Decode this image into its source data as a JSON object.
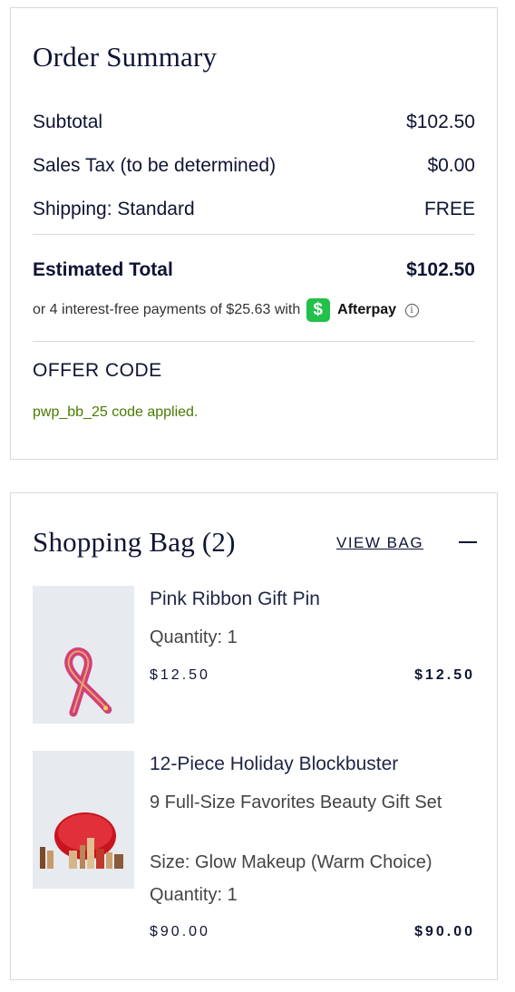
{
  "order_summary": {
    "title": "Order Summary",
    "subtotal_label": "Subtotal",
    "subtotal_value": "$102.50",
    "tax_label": "Sales Tax (to be determined)",
    "tax_value": "$0.00",
    "shipping_label": "Shipping: Standard",
    "shipping_value": "FREE",
    "total_label": "Estimated Total",
    "total_value": "$102.50",
    "afterpay_text": "or 4 interest-free payments of $25.63 with",
    "afterpay_badge": "$",
    "afterpay_name": "Afterpay",
    "afterpay_info": "i",
    "offer_title": "OFFER CODE",
    "offer_applied": "pwp_bb_25 code applied."
  },
  "shopping_bag": {
    "title": "Shopping Bag (2)",
    "view_bag_label": "VIEW BAG",
    "items": [
      {
        "name": "Pink Ribbon Gift Pin",
        "quantity": "Quantity: 1",
        "unit_price": "$12.50",
        "total_price": "$12.50"
      },
      {
        "name": "12-Piece Holiday Blockbuster",
        "subtitle": "9 Full-Size Favorites Beauty Gift Set",
        "size": "Size: Glow Makeup (Warm Choice)",
        "quantity": "Quantity: 1",
        "unit_price": "$90.00",
        "total_price": "$90.00"
      }
    ]
  },
  "colors": {
    "navy_text": "#0f1433",
    "afterpay_green": "#21c14a",
    "offer_green": "#4a7a00",
    "border": "#d9d9de"
  }
}
